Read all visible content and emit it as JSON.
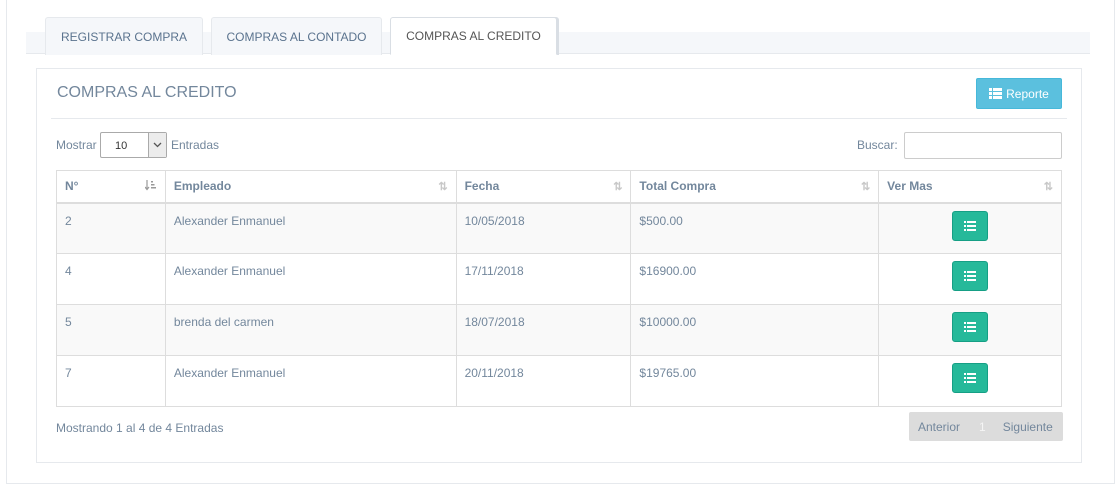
{
  "tabs": [
    {
      "label": "REGISTRAR COMPRA"
    },
    {
      "label": "COMPRAS AL CONTADO"
    },
    {
      "label": "COMPRAS AL CREDITO",
      "active": true
    }
  ],
  "panel": {
    "title": "COMPRAS AL CREDITO",
    "report_button": "Reporte",
    "show_label": "Mostrar",
    "show_value": "10",
    "entries_label": "Entradas",
    "search_label": "Buscar:",
    "search_value": ""
  },
  "table": {
    "headers": [
      "N°",
      "Empleado",
      "Fecha",
      "Total Compra",
      "Ver Mas"
    ],
    "rows": [
      {
        "n": "2",
        "empleado": "Alexander Enmanuel",
        "fecha": "10/05/2018",
        "total": "$500.00"
      },
      {
        "n": "4",
        "empleado": "Alexander Enmanuel",
        "fecha": "17/11/2018",
        "total": "$16900.00"
      },
      {
        "n": "5",
        "empleado": "brenda del carmen",
        "fecha": "18/07/2018",
        "total": "$10000.00"
      },
      {
        "n": "7",
        "empleado": "Alexander Enmanuel",
        "fecha": "20/11/2018",
        "total": "$19765.00"
      }
    ]
  },
  "footer": {
    "info": "Mostrando 1 al 4 de 4 Entradas"
  },
  "pagination": {
    "prev": "Anterior",
    "page": "1",
    "next": "Siguiente"
  },
  "colors": {
    "accent_green": "#26b99a",
    "info_blue": "#5bc0de",
    "text": "#73879c"
  },
  "icons": {
    "report": "list-icon",
    "ver_mas": "list-icon",
    "sort_asc": "sort-asc-icon",
    "sort": "sort-icon"
  }
}
